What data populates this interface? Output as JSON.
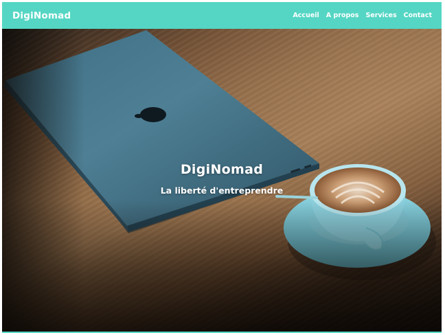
{
  "navbar": {
    "brand": "DigiNomad",
    "links": [
      "Accueil",
      "A propos",
      "Services",
      "Contact"
    ]
  },
  "hero": {
    "title": "DigiNomad",
    "subtitle": "La liberté d'entreprendre",
    "image": "laptop-and-coffee-on-wooden-table"
  },
  "colors": {
    "accent": "#55d6c4",
    "text_on_accent": "#ffffff"
  }
}
